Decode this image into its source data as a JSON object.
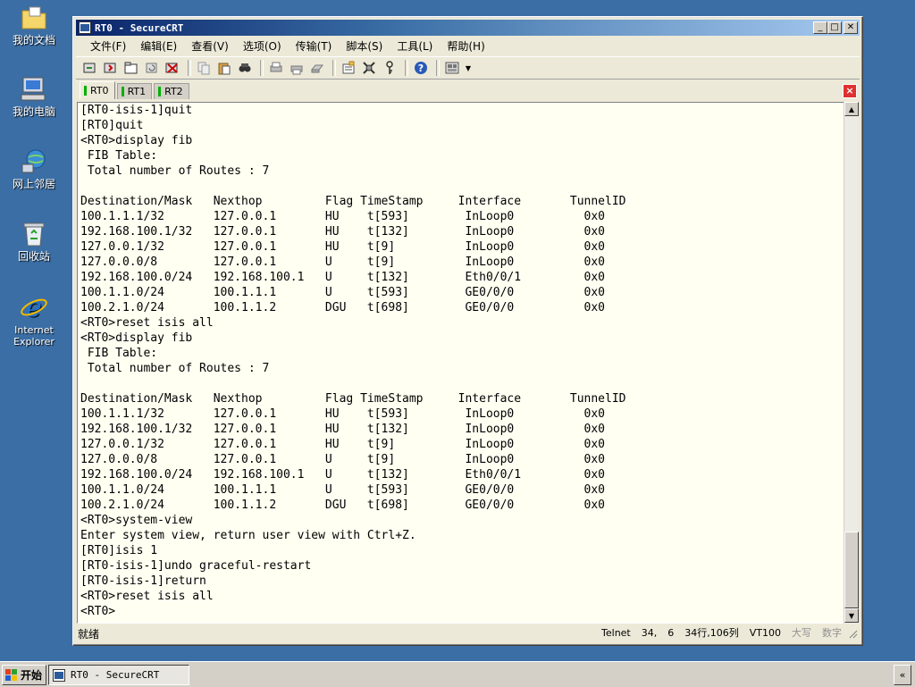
{
  "desktop": {
    "icons": [
      {
        "label": "我的文档",
        "icon": "my-documents-folder-icon"
      },
      {
        "label": "我的电脑",
        "icon": "my-computer-icon"
      },
      {
        "label": "网上邻居",
        "icon": "network-places-icon"
      },
      {
        "label": "回收站",
        "icon": "recycle-bin-icon"
      },
      {
        "label": "Internet Explorer",
        "icon": "internet-explorer-icon"
      }
    ]
  },
  "window": {
    "title": "RT0 - SecureCRT",
    "menu": [
      "文件(F)",
      "编辑(E)",
      "查看(V)",
      "选项(O)",
      "传输(T)",
      "脚本(S)",
      "工具(L)",
      "帮助(H)"
    ],
    "tabs": [
      {
        "label": "RT0",
        "active": true
      },
      {
        "label": "RT1",
        "active": false
      },
      {
        "label": "RT2",
        "active": false
      }
    ],
    "terminal_lines": [
      "[RT0-isis-1]quit",
      "[RT0]quit",
      "<RT0>display fib",
      " FIB Table:",
      " Total number of Routes : 7",
      "",
      "Destination/Mask   Nexthop         Flag TimeStamp     Interface       TunnelID",
      "100.1.1.1/32       127.0.0.1       HU    t[593]        InLoop0          0x0",
      "192.168.100.1/32   127.0.0.1       HU    t[132]        InLoop0          0x0",
      "127.0.0.1/32       127.0.0.1       HU    t[9]          InLoop0          0x0",
      "127.0.0.0/8        127.0.0.1       U     t[9]          InLoop0          0x0",
      "192.168.100.0/24   192.168.100.1   U     t[132]        Eth0/0/1         0x0",
      "100.1.1.0/24       100.1.1.1       U     t[593]        GE0/0/0          0x0",
      "100.2.1.0/24       100.1.1.2       DGU   t[698]        GE0/0/0          0x0",
      "<RT0>reset isis all",
      "<RT0>display fib",
      " FIB Table:",
      " Total number of Routes : 7",
      "",
      "Destination/Mask   Nexthop         Flag TimeStamp     Interface       TunnelID",
      "100.1.1.1/32       127.0.0.1       HU    t[593]        InLoop0          0x0",
      "192.168.100.1/32   127.0.0.1       HU    t[132]        InLoop0          0x0",
      "127.0.0.1/32       127.0.0.1       HU    t[9]          InLoop0          0x0",
      "127.0.0.0/8        127.0.0.1       U     t[9]          InLoop0          0x0",
      "192.168.100.0/24   192.168.100.1   U     t[132]        Eth0/0/1         0x0",
      "100.1.1.0/24       100.1.1.1       U     t[593]        GE0/0/0          0x0",
      "100.2.1.0/24       100.1.1.2       DGU   t[698]        GE0/0/0          0x0",
      "<RT0>system-view",
      "Enter system view, return user view with Ctrl+Z.",
      "[RT0]isis 1",
      "[RT0-isis-1]undo graceful-restart",
      "[RT0-isis-1]return",
      "<RT0>reset isis all",
      "<RT0>"
    ],
    "status": {
      "text": "就绪",
      "protocol": "Telnet",
      "cursor_row": "34,",
      "cursor_col": "6",
      "size": "34行,106列",
      "emulation": "VT100",
      "caps": "大写",
      "num": "数字"
    }
  },
  "taskbar": {
    "start_label": "开始",
    "task_label": "RT0 - SecureCRT",
    "tray_label": "«"
  },
  "colors": {
    "desktop": "#3a6ea5",
    "titlebar_start": "#0a246a",
    "terminal_bg": "#fffff2",
    "tab_status": "#00b000"
  }
}
